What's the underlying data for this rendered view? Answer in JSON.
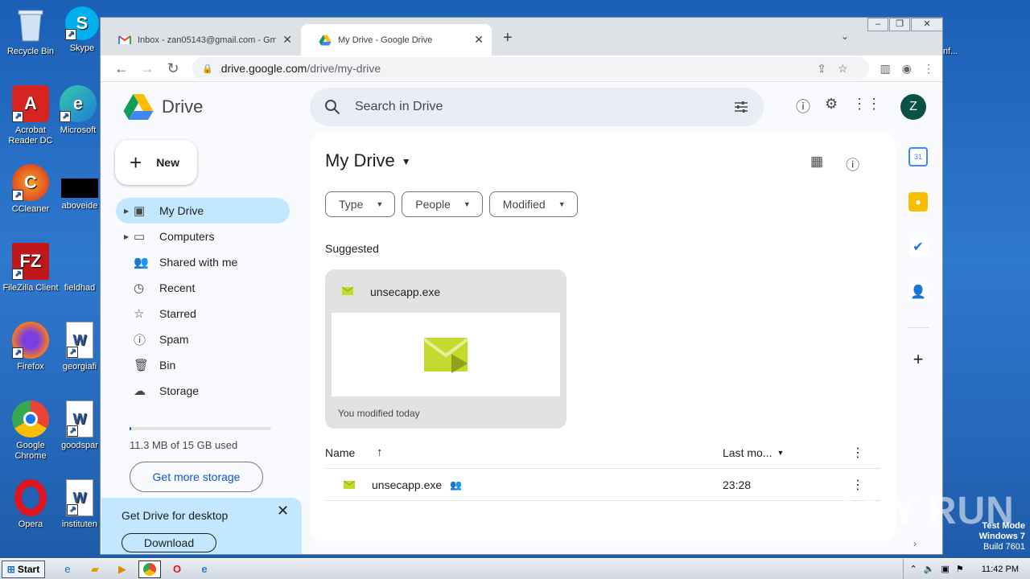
{
  "desktop": {
    "icons": [
      {
        "label": "Recycle Bin"
      },
      {
        "label": "Skype"
      },
      {
        "label": "Acrobat Reader DC"
      },
      {
        "label": "Microsoft"
      },
      {
        "label": "CCleaner"
      },
      {
        "label": "aboveide"
      },
      {
        "label": "FileZilla Client"
      },
      {
        "label": "fieldhad"
      },
      {
        "label": "Firefox"
      },
      {
        "label": "georgiafi"
      },
      {
        "label": "Google Chrome"
      },
      {
        "label": "goodspar"
      },
      {
        "label": "Opera"
      },
      {
        "label": "instituten"
      }
    ],
    "right_partial": "nf..."
  },
  "browser": {
    "tabs": [
      {
        "title": "Inbox - zan05143@gmail.com - Gmail",
        "active": false
      },
      {
        "title": "My Drive - Google Drive",
        "active": true
      }
    ],
    "url_host": "drive.google.com",
    "url_path": "/drive/my-drive"
  },
  "drive": {
    "app_name": "Drive",
    "search_placeholder": "Search in Drive",
    "avatar_letter": "Z",
    "new_label": "New",
    "nav": [
      {
        "label": "My Drive",
        "icon": "my-drive-icon",
        "caret": true
      },
      {
        "label": "Computers",
        "icon": "computers-icon",
        "caret": true
      },
      {
        "label": "Shared with me",
        "icon": "people-icon",
        "caret": false
      },
      {
        "label": "Recent",
        "icon": "clock-icon",
        "caret": false
      },
      {
        "label": "Starred",
        "icon": "star-icon",
        "caret": false
      },
      {
        "label": "Spam",
        "icon": "spam-icon",
        "caret": false
      },
      {
        "label": "Bin",
        "icon": "trash-icon",
        "caret": false
      },
      {
        "label": "Storage",
        "icon": "cloud-icon",
        "caret": false
      }
    ],
    "storage_used": "11.3 MB of 15 GB used",
    "storage_fraction": 0.0008,
    "get_storage_label": "Get more storage",
    "promo": {
      "title": "Get Drive for desktop",
      "button": "Download"
    },
    "page_title": "My Drive",
    "filters": [
      "Type",
      "People",
      "Modified"
    ],
    "suggested_label": "Suggested",
    "suggested_file": {
      "name": "unsecapp.exe",
      "meta": "You modified today"
    },
    "list": {
      "col_name": "Name",
      "col_modified": "Last mo...",
      "rows": [
        {
          "name": "unsecapp.exe",
          "modified": "23:28",
          "shared": true
        }
      ]
    },
    "colors": {
      "accent": "#0b57d0",
      "nav_active": "#c2e7ff",
      "file_icon": "#c5d82e"
    }
  },
  "taskbar": {
    "start_label": "Start",
    "clock": "11:42 PM"
  },
  "overlay": {
    "watermark": "ANY RUN",
    "test_mode": "Test Mode",
    "os": "Windows 7",
    "build": "Build 7601"
  }
}
